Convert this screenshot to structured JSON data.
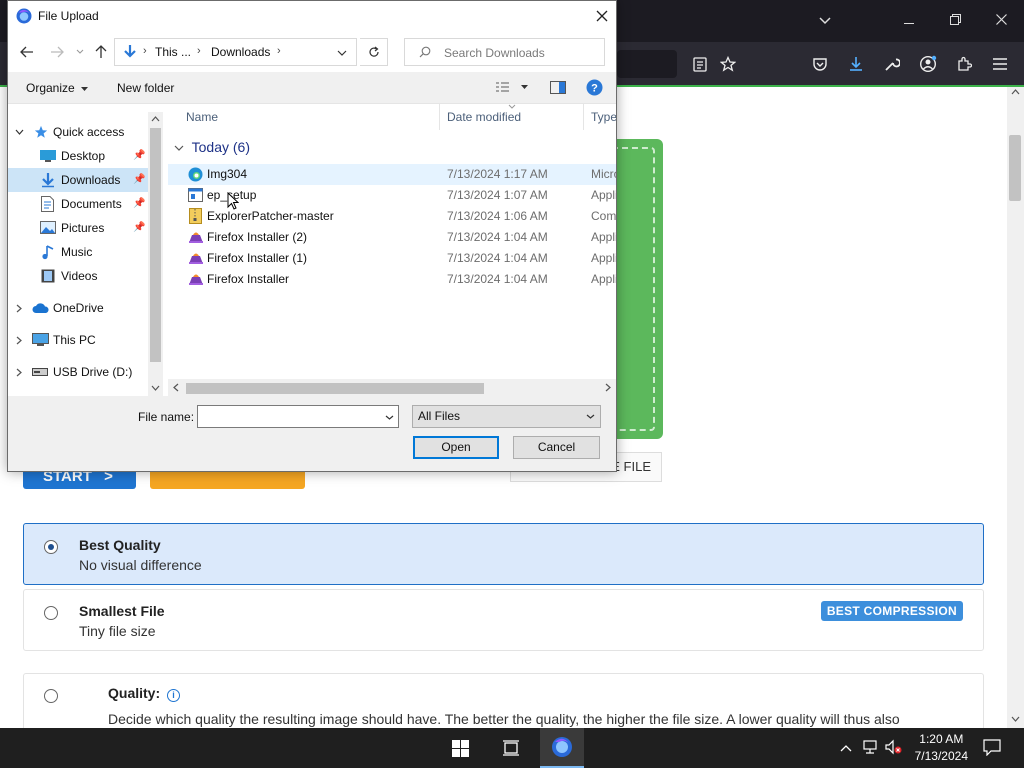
{
  "browser": {
    "toolbar_icons": [
      "reader-view-icon",
      "bookmark-star-icon",
      "pocket-icon",
      "downloads-icon",
      "tools-icon",
      "account-icon",
      "extensions-icon",
      "menu-icon"
    ]
  },
  "page": {
    "start_label": "START",
    "choose_file_label": "E FILE",
    "options": [
      {
        "title": "Best Quality",
        "subtitle": "No visual difference",
        "selected": true
      },
      {
        "title": "Smallest File",
        "subtitle": "Tiny file size",
        "badge": "BEST COMPRESSION",
        "selected": false
      },
      {
        "title": "Quality:",
        "description": "Decide which quality the resulting image should have. The better the quality, the higher the file size. A lower quality will thus also",
        "selected": false
      }
    ]
  },
  "dialog": {
    "title": "File Upload",
    "breadcrumb": [
      "This ...",
      "Downloads"
    ],
    "search_placeholder": "Search Downloads",
    "organize_label": "Organize",
    "new_folder_label": "New folder",
    "nav": [
      {
        "label": "Quick access",
        "icon": "star-icon",
        "level": 0,
        "expanded": true
      },
      {
        "label": "Desktop",
        "icon": "desktop-icon",
        "level": 1,
        "pinned": true
      },
      {
        "label": "Downloads",
        "icon": "downloads-folder-icon",
        "level": 1,
        "pinned": true,
        "selected": true
      },
      {
        "label": "Documents",
        "icon": "documents-icon",
        "level": 1,
        "pinned": true
      },
      {
        "label": "Pictures",
        "icon": "pictures-icon",
        "level": 1,
        "pinned": true
      },
      {
        "label": "Music",
        "icon": "music-icon",
        "level": 1
      },
      {
        "label": "Videos",
        "icon": "videos-icon",
        "level": 1
      },
      {
        "label": "OneDrive",
        "icon": "onedrive-icon",
        "level": 0
      },
      {
        "label": "This PC",
        "icon": "this-pc-icon",
        "level": 0
      },
      {
        "label": "USB Drive (D:)",
        "icon": "usb-drive-icon",
        "level": 0
      }
    ],
    "columns": {
      "name": "Name",
      "date": "Date modified",
      "type": "Type"
    },
    "group_label": "Today (6)",
    "files": [
      {
        "name": "Img304",
        "date": "7/13/2024 1:17 AM",
        "type": "Micro",
        "icon": "edge-icon"
      },
      {
        "name": "ep_setup",
        "date": "7/13/2024 1:07 AM",
        "type": "Appli",
        "icon": "app-icon"
      },
      {
        "name": "ExplorerPatcher-master",
        "date": "7/13/2024 1:06 AM",
        "type": "Comp",
        "icon": "zip-icon"
      },
      {
        "name": "Firefox Installer (2)",
        "date": "7/13/2024 1:04 AM",
        "type": "Appli",
        "icon": "installer-icon"
      },
      {
        "name": "Firefox Installer (1)",
        "date": "7/13/2024 1:04 AM",
        "type": "Appli",
        "icon": "installer-icon"
      },
      {
        "name": "Firefox Installer",
        "date": "7/13/2024 1:04 AM",
        "type": "Appli",
        "icon": "installer-icon"
      }
    ],
    "file_name_label": "File name:",
    "file_name_value": "",
    "file_type": "All Files",
    "open_label": "Open",
    "cancel_label": "Cancel"
  },
  "taskbar": {
    "time": "1:20 AM",
    "date": "7/13/2024"
  }
}
